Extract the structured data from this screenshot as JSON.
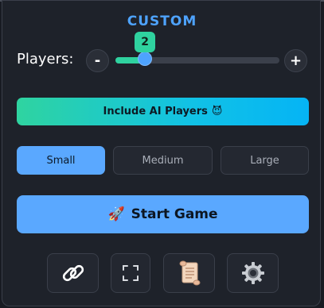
{
  "mode": {
    "title": "CUSTOM"
  },
  "players": {
    "label": "Players:",
    "decrement_label": "-",
    "increment_label": "+",
    "value": "2",
    "value_fraction": 0.18
  },
  "ai_toggle": {
    "label": "Include AI Players",
    "emoji": "😈"
  },
  "board_size": {
    "options": [
      "Small",
      "Medium",
      "Large"
    ],
    "selected": "Small"
  },
  "start": {
    "label": "Start Game",
    "emoji": "🚀"
  },
  "toolbar": {
    "icons": [
      "link-icon",
      "fullscreen-icon",
      "scroll-icon",
      "gear-icon"
    ]
  },
  "colors": {
    "accent_blue": "#5aa8ff",
    "accent_green": "#2fd29f",
    "background": "#1e222a"
  }
}
